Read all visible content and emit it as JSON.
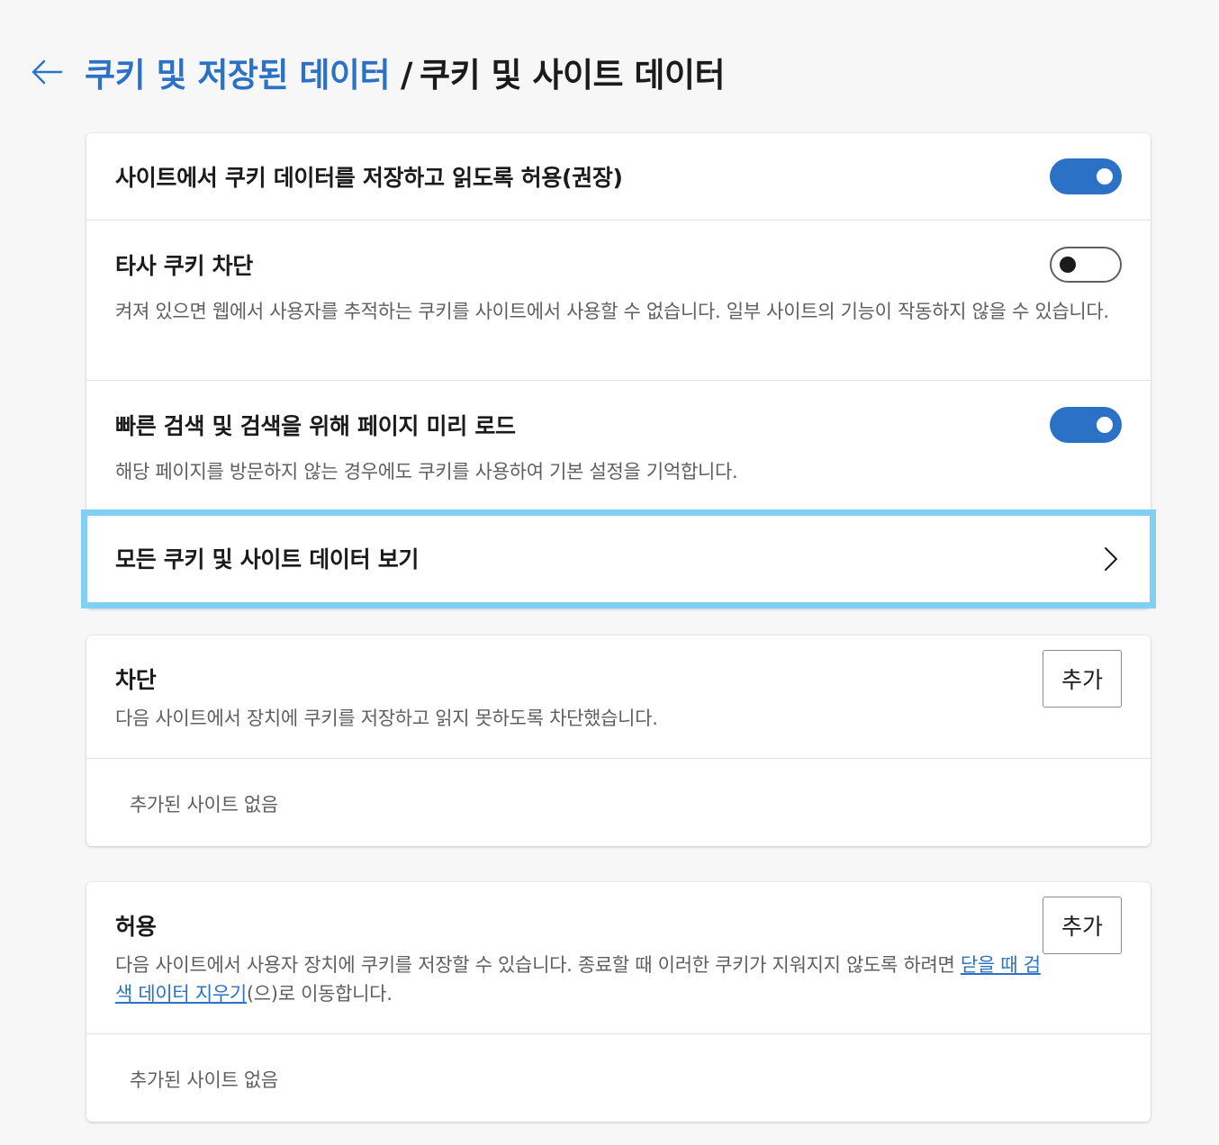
{
  "header": {
    "back_icon": "arrow-left-icon",
    "breadcrumb_parent": "쿠키 및 저장된 데이터",
    "separator": "/",
    "breadcrumb_current": "쿠키 및 사이트 데이터"
  },
  "settings": {
    "allow_cookies": {
      "title": "사이트에서 쿠키 데이터를 저장하고 읽도록 허용(권장)",
      "enabled": true
    },
    "block_third_party": {
      "title": "타사 쿠키 차단",
      "description": "켜져 있으면 웹에서 사용자를 추적하는 쿠키를 사이트에서 사용할 수 없습니다. 일부 사이트의 기능이 작동하지 않을 수 있습니다.",
      "enabled": false
    },
    "preload_pages": {
      "title": "빠른 검색 및 검색을 위해 페이지 미리 로드",
      "description": "해당 페이지를 방문하지 않는 경우에도 쿠키를 사용하여 기본 설정을 기억합니다.",
      "enabled": true
    },
    "view_all": {
      "title": "모든 쿠키 및 사이트 데이터 보기",
      "icon": "chevron-right-icon"
    }
  },
  "block": {
    "title": "차단",
    "description": "다음 사이트에서 장치에 쿠키를 저장하고 읽지 못하도록 차단했습니다.",
    "add_label": "추가",
    "empty_text": "추가된 사이트 없음"
  },
  "allow": {
    "title": "허용",
    "description_before": "다음 사이트에서 사용자 장치에 쿠키를 저장할 수 있습니다. 종료할 때 이러한 쿠키가 지워지지 않도록 하려면 ",
    "link_text": "닫을 때 검색 데이터 지우기",
    "description_after": "(으)로 이동합니다.",
    "add_label": "추가",
    "empty_text": "추가된 사이트 없음"
  },
  "colors": {
    "accent": "#2b72c7",
    "highlight_border": "#7fd0f2",
    "background": "#f7f7f7"
  }
}
